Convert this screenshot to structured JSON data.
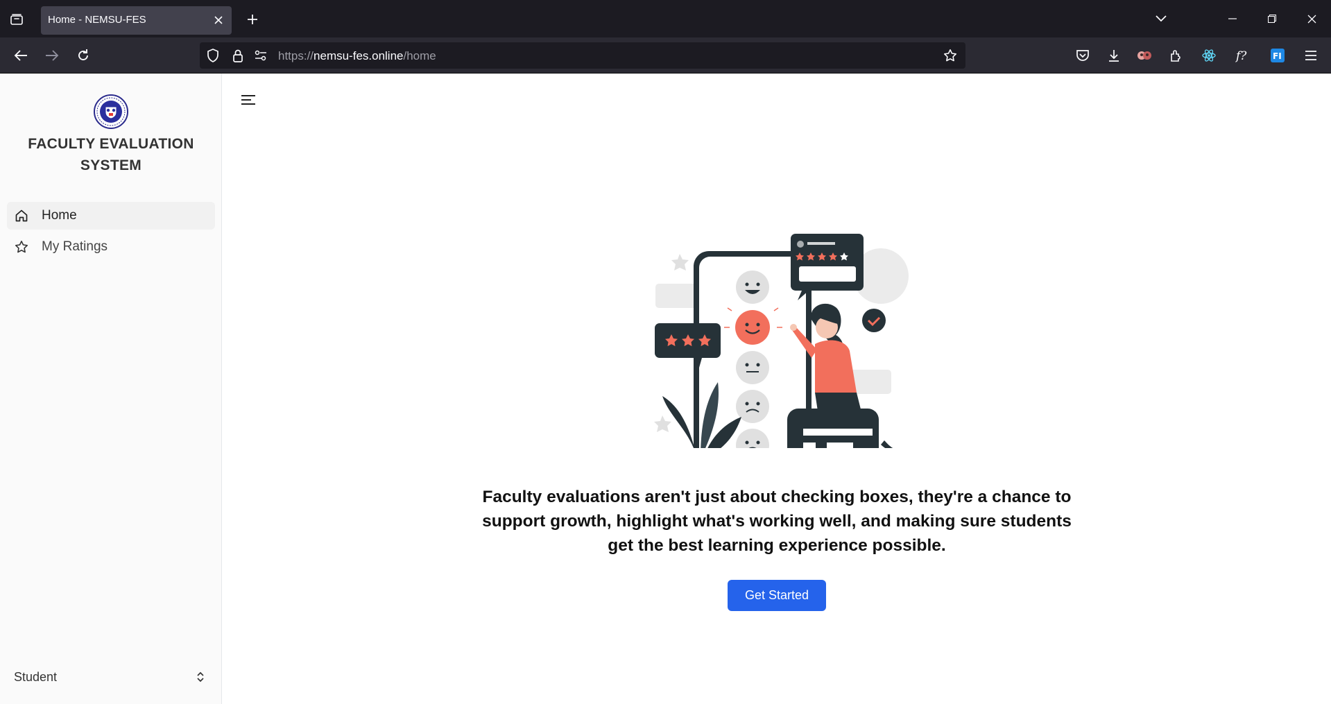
{
  "browser": {
    "tab_title": "Home - NEMSU-FES",
    "url": {
      "scheme": "https://",
      "host": "nemsu-fes.online",
      "path": "/home"
    }
  },
  "sidebar": {
    "app_title": "FACULTY EVALUATION SYSTEM",
    "items": [
      {
        "label": "Home",
        "icon": "home-icon",
        "active": true
      },
      {
        "label": "My Ratings",
        "icon": "star-icon",
        "active": false
      }
    ],
    "role": "Student"
  },
  "main": {
    "tagline": "Faculty evaluations aren't just about checking boxes, they're a chance to support growth, highlight what's working well, and making sure students get the best learning experience possible.",
    "cta_label": "Get Started"
  },
  "colors": {
    "accent": "#2563eb",
    "illustration_accent": "#f26f5c",
    "dark": "#263238"
  }
}
